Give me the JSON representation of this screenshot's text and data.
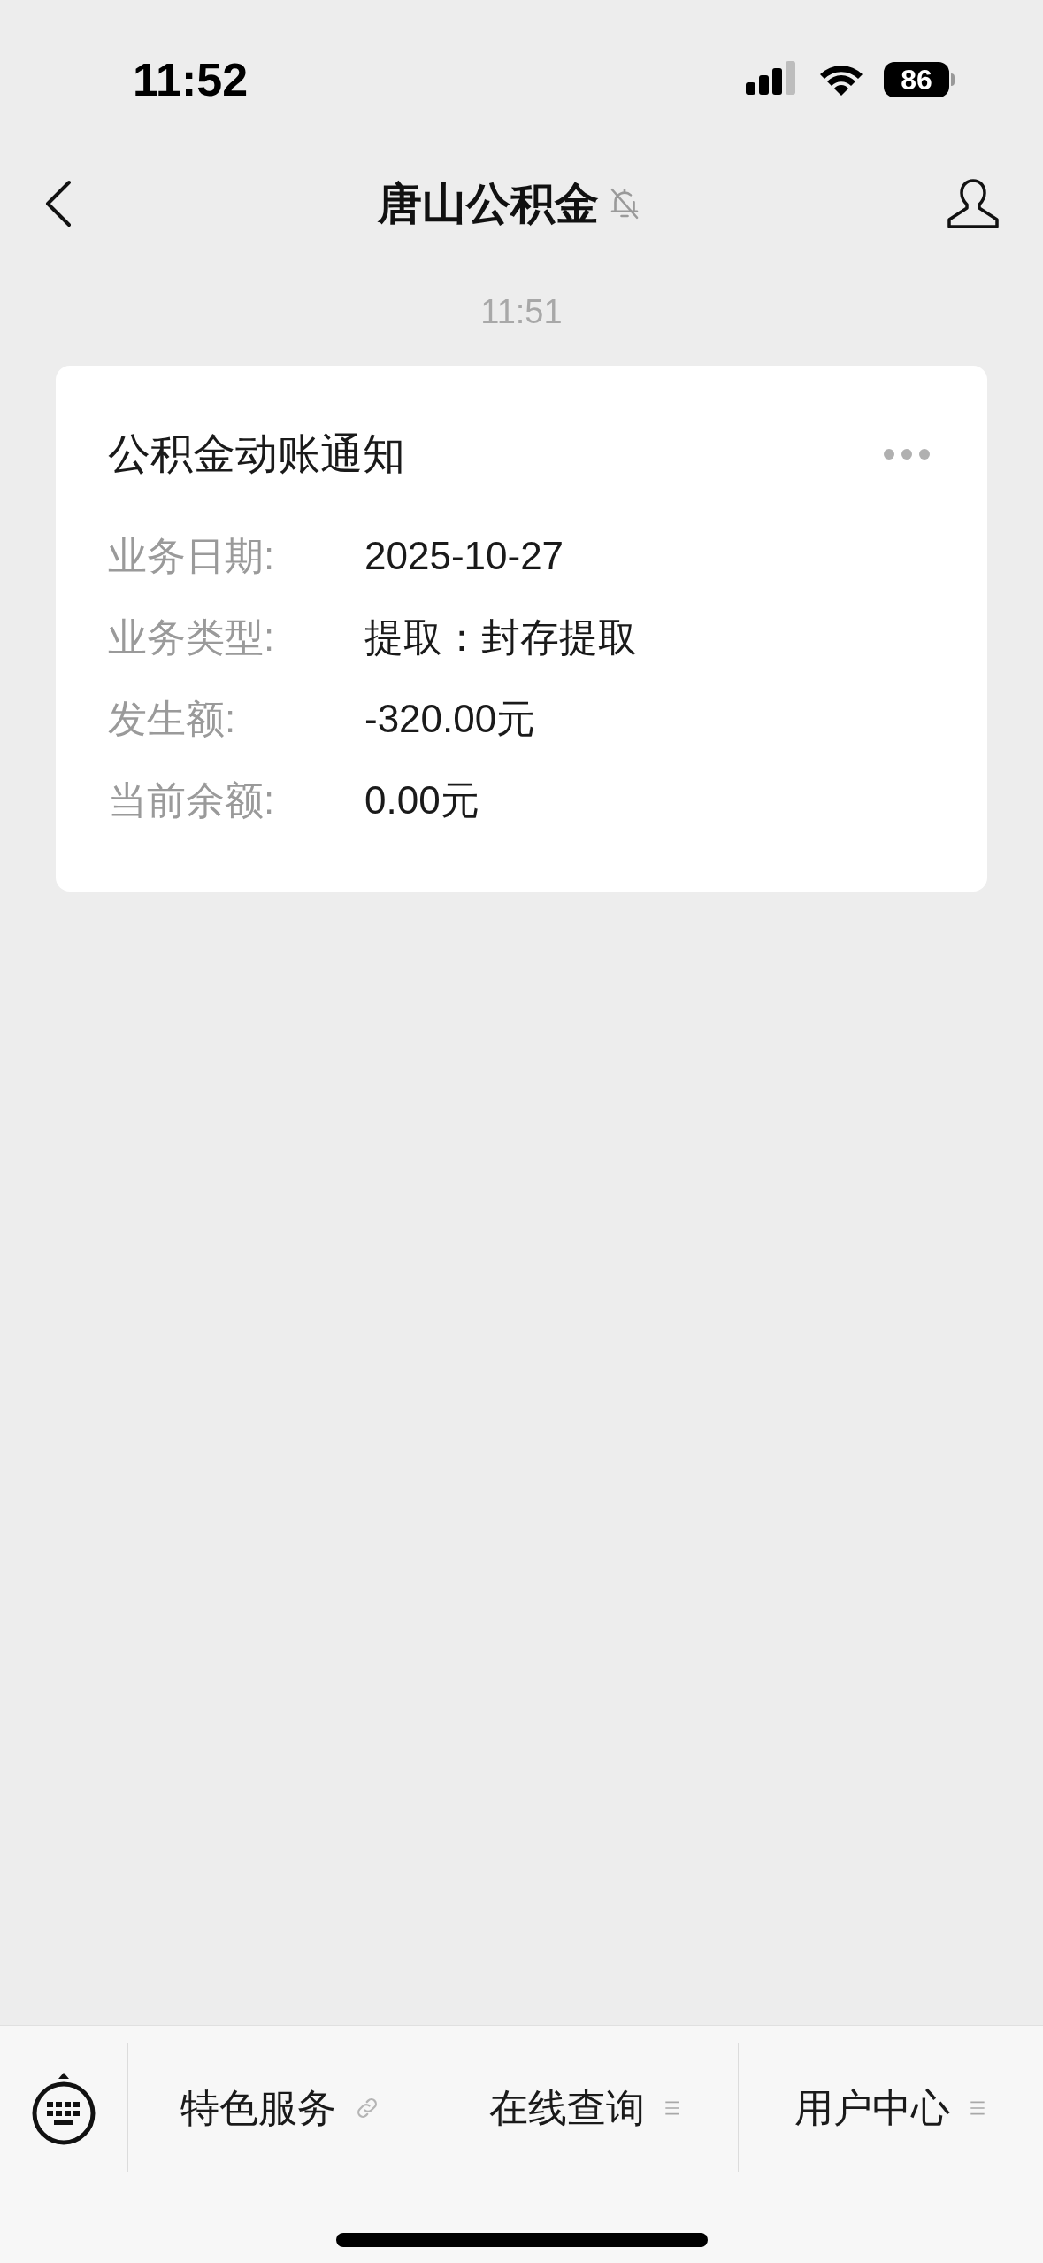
{
  "status_bar": {
    "time": "11:52",
    "battery": "86"
  },
  "nav": {
    "title": "唐山公积金",
    "muted": true
  },
  "timestamp": "11:51",
  "card": {
    "title": "公积金动账通知",
    "rows": [
      {
        "label": "业务日期:",
        "value": "2025-10-27"
      },
      {
        "label": "业务类型:",
        "value": "提取：封存提取"
      },
      {
        "label": "发生额:",
        "value": "-320.00元"
      },
      {
        "label": "当前余额:",
        "value": "0.00元"
      }
    ]
  },
  "menu": [
    {
      "label": "特色服务",
      "kind": "link"
    },
    {
      "label": "在线查询",
      "kind": "submenu"
    },
    {
      "label": "用户中心",
      "kind": "submenu"
    }
  ]
}
